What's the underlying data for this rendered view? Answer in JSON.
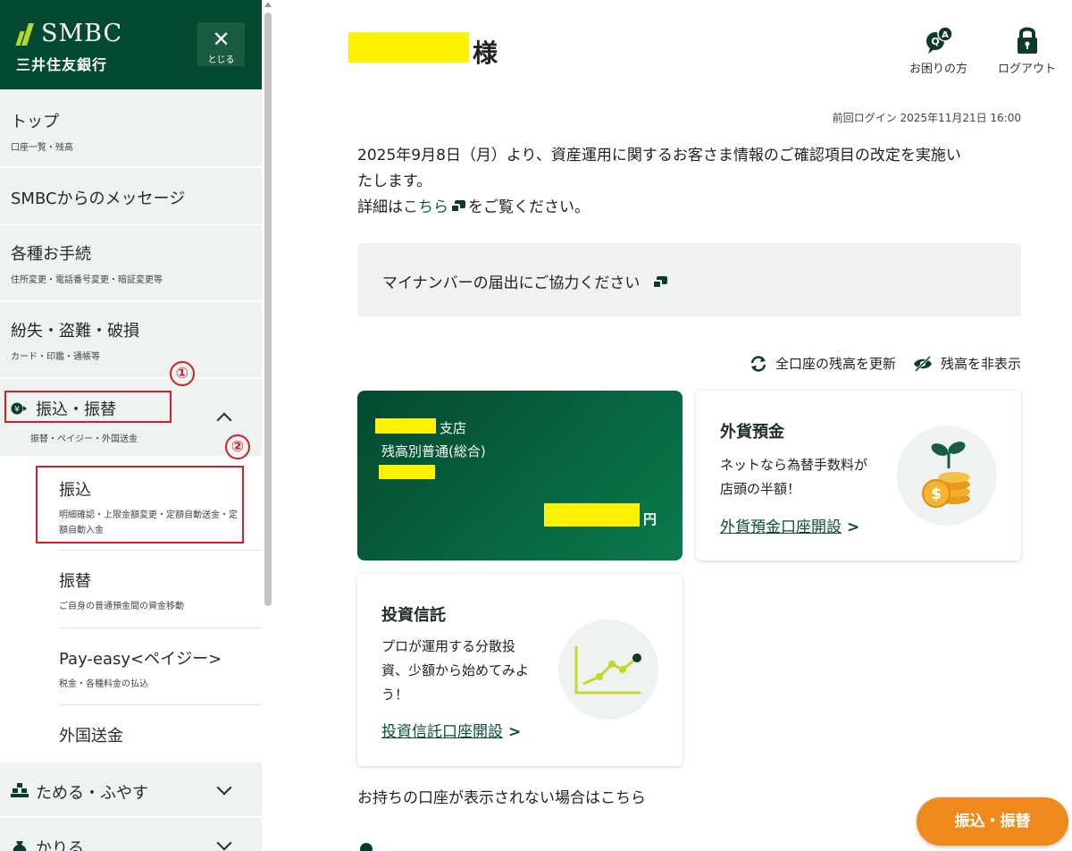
{
  "sidebar": {
    "logo_en": "SMBC",
    "logo_jp": "三井住友銀行",
    "close_label": "とじる",
    "items": [
      {
        "title": "トップ",
        "sub": "口座一覧・残高"
      },
      {
        "title": "SMBCからのメッセージ",
        "sub": ""
      },
      {
        "title": "各種お手続",
        "sub": "住所変更・電話番号変更・暗証変更等"
      },
      {
        "title": "紛失・盗難・破損",
        "sub": "カード・印鑑・通帳等"
      },
      {
        "title": "振込・振替",
        "sub": "振替・ペイジー・外国送金"
      },
      {
        "title": "ためる・ふやす",
        "sub": ""
      },
      {
        "title": "かりる",
        "sub": ""
      }
    ],
    "subitems": [
      {
        "title": "振込",
        "sub": "明細確認・上限金額変更・定額自動送金・定額自動入金"
      },
      {
        "title": "振替",
        "sub": "ご自身の普通預金間の資金移動"
      },
      {
        "title": "Pay-easy<ペイジー>",
        "sub": "税金・各種料金の払込"
      },
      {
        "title": "外国送金",
        "sub": ""
      }
    ],
    "annotations": [
      "①",
      "②"
    ]
  },
  "header": {
    "name_suffix": "様",
    "help_label": "お困りの方",
    "logout_label": "ログアウト",
    "last_login": "前回ログイン 2025年11月21日 16:00"
  },
  "notice": {
    "line1": "2025年9月8日（月）より、資産運用に関するお客さま情報のご確認項目の改定を実施い",
    "line2": "たします。",
    "line3_pre": "詳細は",
    "line3_link": "こちら",
    "line3_post": "をご覧ください。"
  },
  "mynumber": {
    "label": "マイナンバーの届出にご協力ください"
  },
  "balance_actions": {
    "refresh": "全口座の残高を更新",
    "hide": "残高を非表示"
  },
  "account_card": {
    "branch_suffix": "支店",
    "type": "残高別普通(総合)",
    "currency": "円"
  },
  "foreign_card": {
    "title": "外貨預金",
    "desc1": "ネットなら為替手数料が",
    "desc2": "店頭の半額！",
    "link": "外貨預金口座開設"
  },
  "fund_card": {
    "title": "投資信託",
    "desc1": "プロが運用する分散投",
    "desc2": "資、少額から始めてみよ",
    "desc3": "う！",
    "link": "投資信託口座開設"
  },
  "no_account": "お持ちの口座が表示されない場合はこちら",
  "fab_label": "振込・振替",
  "colors": {
    "brand": "#044a30",
    "accent": "#b7d72a",
    "fab": "#f08a1d",
    "annotation": "#d0202a",
    "highlight": "#fff200"
  }
}
